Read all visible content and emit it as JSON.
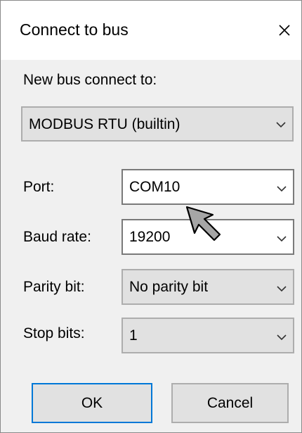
{
  "dialog": {
    "title": "Connect to bus",
    "close_icon": "close-icon"
  },
  "bus": {
    "label": "New bus connect to:",
    "selected": "MODBUS RTU (builtin)"
  },
  "fields": {
    "port": {
      "label": "Port:",
      "value": "COM10"
    },
    "baud_rate": {
      "label": "Baud rate:",
      "value": "19200"
    },
    "parity_bit": {
      "label": "Parity bit:",
      "value": "No parity bit"
    },
    "stop_bits": {
      "label": "Stop bits:",
      "value": "1"
    }
  },
  "buttons": {
    "ok_label": "OK",
    "cancel_label": "Cancel"
  },
  "colors": {
    "default_button_border": "#0078d7",
    "dialog_background": "#f0f0f0"
  }
}
